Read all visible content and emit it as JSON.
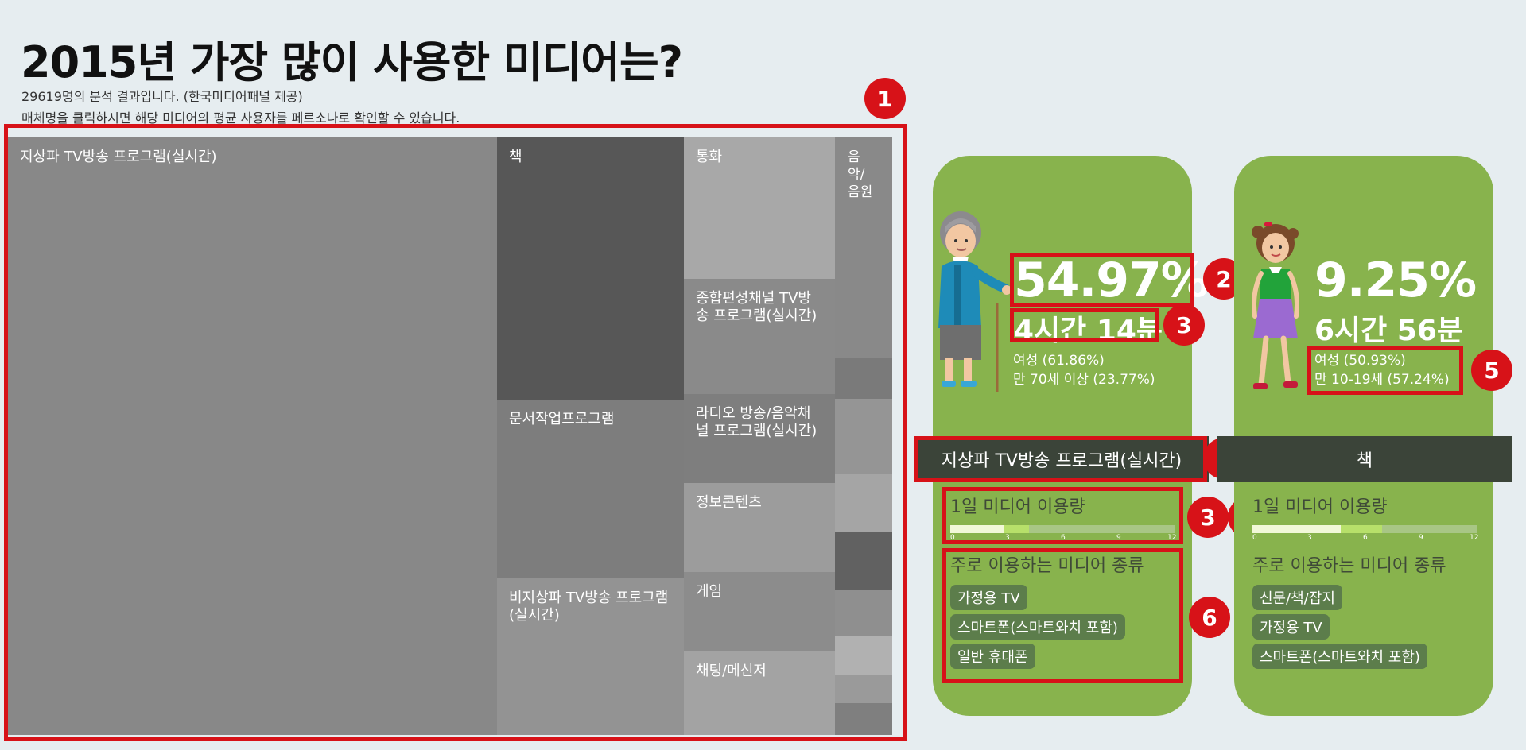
{
  "header": {
    "title": "2015년 가장 많이 사용한 미디어는?",
    "line1": "29619명의 분석 결과입니다. (한국미디어패널 제공)",
    "line2": "매체명을 클릭하시면 해당 미디어의 평균 사용자를 페르소나로 확인할 수 있습니다."
  },
  "treemap": {
    "cells": [
      {
        "label": "지상파 TV방송 프로그램(실시간)",
        "color": "#888888"
      },
      {
        "label": "책",
        "color": "#575757"
      },
      {
        "label": "문서작업프로그램",
        "color": "#7d7d7d"
      },
      {
        "label": "비지상파 TV방송 프로그램(실시간)",
        "color": "#939393"
      },
      {
        "label": "통화",
        "color": "#a8a8a8"
      },
      {
        "label": "종합편성채널 TV방송 프로그램(실시간)",
        "color": "#8a8a8a"
      },
      {
        "label": "라디오 방송/음악채널 프로그램(실시간)",
        "color": "#7e7e7e"
      },
      {
        "label": "정보콘텐츠",
        "color": "#9c9c9c"
      },
      {
        "label": "게임",
        "color": "#8c8c8c"
      },
      {
        "label": "채팅/메신저",
        "color": "#a3a3a3"
      },
      {
        "label": "음악/음원",
        "color": "#898989"
      }
    ]
  },
  "annotations": [
    "1",
    "2",
    "3",
    "2",
    "3",
    "4",
    "5",
    "6"
  ],
  "persona_left": {
    "percent": "54.97%",
    "time": "4시간 14분",
    "gender": "여성 (61.86%)",
    "age": "만 70세 이상 (23.77%)",
    "media_name": "지상파 TV방송 프로그램(실시간)",
    "usage_label": "1일 미디어 이용량",
    "usage_hours": 4.23,
    "ticks": [
      "0",
      "3",
      "6",
      "9",
      "12"
    ],
    "types_label": "주로 이용하는 미디어 종류",
    "types": [
      "가정용 TV",
      "스마트폰(스마트와치 포함)",
      "일반 휴대폰"
    ]
  },
  "persona_right": {
    "percent": "9.25%",
    "time": "6시간 56분",
    "gender": "여성 (50.93%)",
    "age": "만 10-19세 (57.24%)",
    "media_name": "책",
    "usage_label": "1일 미디어 이용량",
    "usage_hours": 6.93,
    "ticks": [
      "0",
      "3",
      "6",
      "9",
      "12"
    ],
    "types_label": "주로 이용하는 미디어 종류",
    "types": [
      "신문/책/잡지",
      "가정용 TV",
      "스마트폰(스마트와치 포함)"
    ]
  },
  "colors": {
    "card": "#88b34d",
    "tab": "#3b4439",
    "chip": "#5c7d4b",
    "highlight": "#d71218",
    "bar_light": "#f1f8d8",
    "bar_mid": "#b7e06a"
  }
}
